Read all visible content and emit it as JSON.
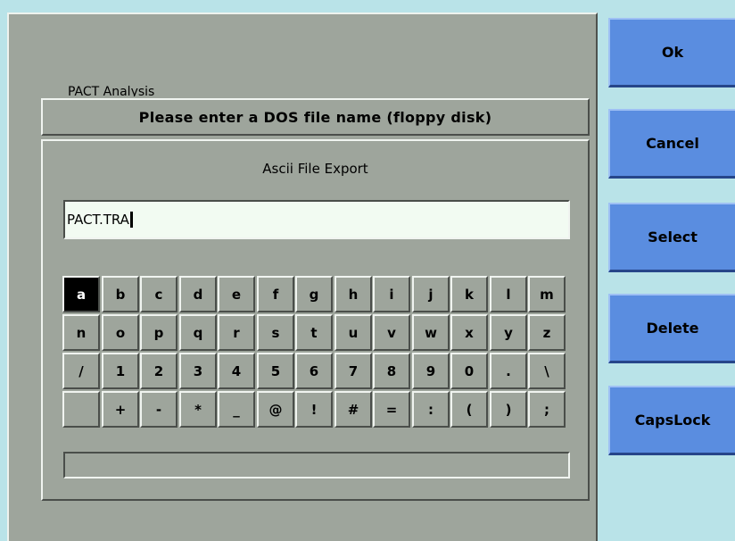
{
  "background_title": "PACT Analysis",
  "dialog": {
    "header": "Please enter a DOS file name (floppy disk)",
    "subtitle": "Ascii File Export",
    "input_value": "PACT.TRA",
    "status_text": ""
  },
  "keyboard": {
    "selected_key": "a",
    "rows": [
      [
        "a",
        "b",
        "c",
        "d",
        "e",
        "f",
        "g",
        "h",
        "i",
        "j",
        "k",
        "l",
        "m"
      ],
      [
        "n",
        "o",
        "p",
        "q",
        "r",
        "s",
        "t",
        "u",
        "v",
        "w",
        "x",
        "y",
        "z"
      ],
      [
        "/",
        "1",
        "2",
        "3",
        "4",
        "5",
        "6",
        "7",
        "8",
        "9",
        "0",
        ".",
        "\\"
      ],
      [
        "",
        "+",
        "-",
        "*",
        "_",
        "@",
        "!",
        "#",
        "=",
        ":",
        "(",
        ")",
        ";"
      ]
    ]
  },
  "softkeys": {
    "ok": "Ok",
    "cancel": "Cancel",
    "select": "Select",
    "delete": "Delete",
    "capslock": "CapsLock"
  },
  "colors": {
    "panel_gray": "#9ea59c",
    "softkey_blue": "#5a8de0",
    "background_cyan": "#b9e3e8",
    "input_bg": "#f2fbf2"
  }
}
